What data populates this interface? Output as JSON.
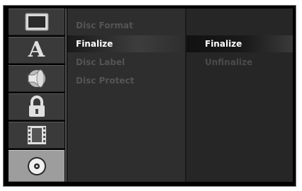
{
  "sidebar": {
    "icons": [
      {
        "name": "tv-screen-icon",
        "selected": false
      },
      {
        "name": "language-a-icon",
        "selected": false
      },
      {
        "name": "speaker-audio-icon",
        "selected": false
      },
      {
        "name": "padlock-icon",
        "selected": false
      },
      {
        "name": "film-strip-icon",
        "selected": false
      },
      {
        "name": "disc-icon",
        "selected": true
      }
    ],
    "letter": "A"
  },
  "menu": {
    "items": [
      {
        "label": "Disc Format"
      },
      {
        "label": "Finalize"
      },
      {
        "label": "Disc Label"
      },
      {
        "label": "Disc Protect"
      }
    ],
    "active_index": 1
  },
  "submenu": {
    "items": [
      {
        "label": "Finalize"
      },
      {
        "label": "Unfinalize"
      }
    ],
    "active_index": 0
  },
  "colors": {
    "frame": "#000000",
    "panel": "#2e2e2e",
    "text_active": "#ffffff",
    "text_inactive": "#545454"
  }
}
